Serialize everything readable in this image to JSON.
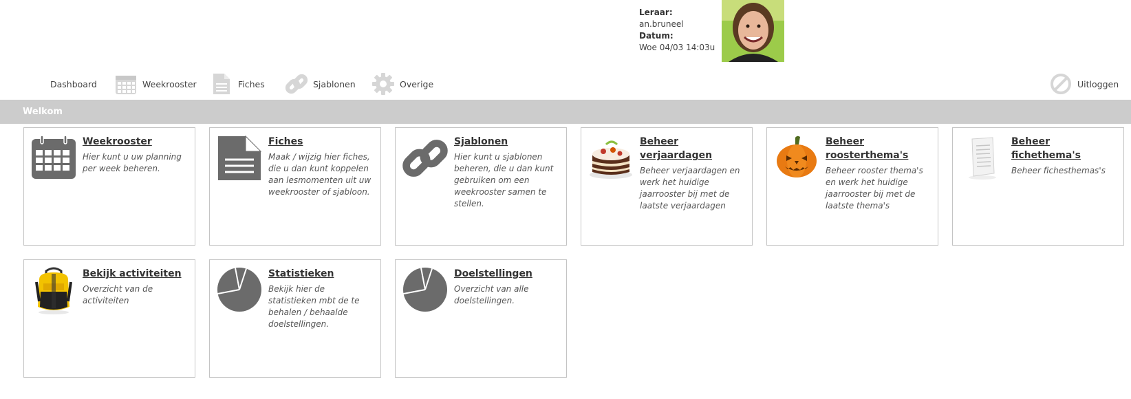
{
  "header": {
    "teacher_label": "Leraar:",
    "teacher_value": "an.bruneel",
    "date_label": "Datum:",
    "date_value": "Woe 04/03 14:03u"
  },
  "nav": {
    "dashboard": "Dashboard",
    "weekrooster": "Weekrooster",
    "fiches": "Fiches",
    "sjablonen": "Sjablonen",
    "overige": "Overige",
    "uitloggen": "Uitloggen"
  },
  "welcome": "Welkom",
  "cards": [
    {
      "title": "Weekrooster",
      "desc": "Hier kunt u uw planning per week beheren.",
      "icon": "calendar-icon"
    },
    {
      "title": "Fiches",
      "desc": "Maak / wijzig hier fiches, die u dan kunt koppelen aan lesmomenten uit uw weekrooster of sjabloon.",
      "icon": "document-icon"
    },
    {
      "title": "Sjablonen",
      "desc": "Hier kunt u sjablonen beheren, die u dan kunt gebruiken om een weekrooster samen te stellen.",
      "icon": "chain-link-icon"
    },
    {
      "title": "Beheer verjaardagen",
      "desc": "Beheer verjaardagen en werk het huidige jaarrooster bij met de laatste verjaardagen",
      "icon": "cake-icon"
    },
    {
      "title": "Beheer roosterthema's",
      "desc": "Beheer rooster thema's en werk het huidige jaarrooster bij met de laatste thema's",
      "icon": "pumpkin-icon"
    },
    {
      "title": "Beheer fichethema's",
      "desc": "Beheer fichesthemas's",
      "icon": "paper-icon"
    },
    {
      "title": "Bekijk activiteiten",
      "desc": "Overzicht van de activiteiten",
      "icon": "backpack-icon"
    },
    {
      "title": "Statistieken",
      "desc": "Bekijk hier de statistieken mbt de te behalen / behaalde doelstellingen.",
      "icon": "pie-chart-icon"
    },
    {
      "title": "Doelstellingen",
      "desc": "Overzicht van alle doelstellingen.",
      "icon": "pie-chart-icon"
    }
  ],
  "colors": {
    "welcome_bar": "#cccccc",
    "icon_dark": "#6b6b6b",
    "nav_icon": "#d4d4d4"
  }
}
